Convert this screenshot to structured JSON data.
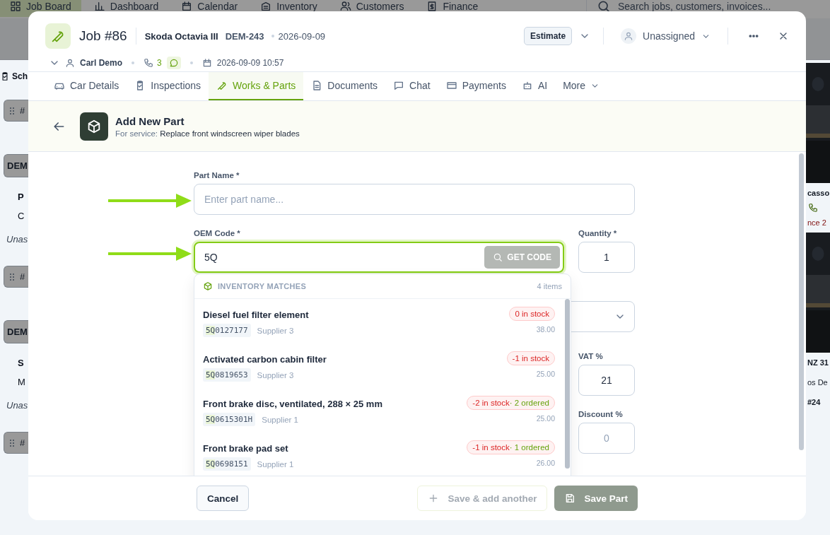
{
  "background": {
    "nav": [
      {
        "label": "Job Board",
        "selected": true
      },
      {
        "label": "Dashboard",
        "selected": false
      },
      {
        "label": "Calendar",
        "selected": false
      },
      {
        "label": "Inventory",
        "selected": false
      },
      {
        "label": "Customers",
        "selected": false
      },
      {
        "label": "Finance",
        "selected": false
      }
    ],
    "search": {
      "placeholder": "Search jobs, customers, invoices..."
    },
    "toolbar_label": "Sch",
    "left_cards": [
      {
        "number": "#",
        "plate": "DEM",
        "car": "P",
        "owner": "C",
        "assignee": "Unas"
      },
      {
        "number": "#",
        "plate": "DEM",
        "car": "S",
        "owner": "M",
        "assignee": "Unas"
      }
    ],
    "left_last_number": "#",
    "right_cards": [
      {
        "car": "casso",
        "due": "nce 2"
      },
      {
        "car": "NZ 31",
        "owner": "os De"
      }
    ],
    "bottom_number": "#24"
  },
  "job": {
    "title": "Job #86",
    "car": "Skoda Octavia III",
    "plate": "DEM-243",
    "date": "2026-09-09",
    "status": "Estimate",
    "assignee": "Unassigned",
    "customer": "Carl Demo",
    "calls": "3",
    "created": "2026-09-09 10:57"
  },
  "tabs": [
    {
      "label": "Car Details",
      "selected": false
    },
    {
      "label": "Inspections",
      "selected": false
    },
    {
      "label": "Works & Parts",
      "selected": true
    },
    {
      "label": "Documents",
      "selected": false
    },
    {
      "label": "Chat",
      "selected": false
    },
    {
      "label": "Payments",
      "selected": false
    },
    {
      "label": "AI",
      "selected": false
    },
    {
      "label": "More",
      "selected": false
    }
  ],
  "panel": {
    "title": "Add New Part",
    "service_label": "For service:",
    "service": "Replace front windscreen wiper blades"
  },
  "form": {
    "part_name": {
      "label": "Part Name *",
      "placeholder": "Enter part name..."
    },
    "oem_code": {
      "label": "OEM Code *",
      "value": "5Q",
      "button": "GET CODE",
      "button_disabled": true
    },
    "quantity": {
      "label": "Quantity *",
      "value": "1"
    },
    "vat": {
      "label": "VAT %",
      "value": "21"
    },
    "discount": {
      "label": "Discount %",
      "placeholder": "0"
    }
  },
  "matches": {
    "title": "INVENTORY MATCHES",
    "count": "4 items",
    "items": [
      {
        "name": "Diesel fuel filter element",
        "code_match": "5Q",
        "code_rest": "0127177",
        "supplier": "Supplier 3",
        "stock": "0 in stock",
        "price": "38.00"
      },
      {
        "name": "Activated carbon cabin filter",
        "code_match": "5Q",
        "code_rest": "0819653",
        "supplier": "Supplier 3",
        "stock": "-1 in stock",
        "price": "25.00"
      },
      {
        "name": "Front brake disc, ventilated, 288 × 25 mm",
        "code_match": "5Q",
        "code_rest": "0615301H",
        "supplier": "Supplier 1",
        "stock": "-2 in stock",
        "ordered": "· 2 ordered",
        "price": "25.00"
      },
      {
        "name": "Front brake pad set",
        "code_match": "5Q",
        "code_rest": "0698151",
        "supplier": "Supplier 1",
        "stock": "-1 in stock",
        "ordered": "· 1 ordered",
        "price": "26.00"
      }
    ]
  },
  "footer": {
    "cancel": "Cancel",
    "save_another": {
      "label": "Save & add another",
      "disabled": true
    },
    "save": {
      "label": "Save Part",
      "disabled": true
    }
  }
}
